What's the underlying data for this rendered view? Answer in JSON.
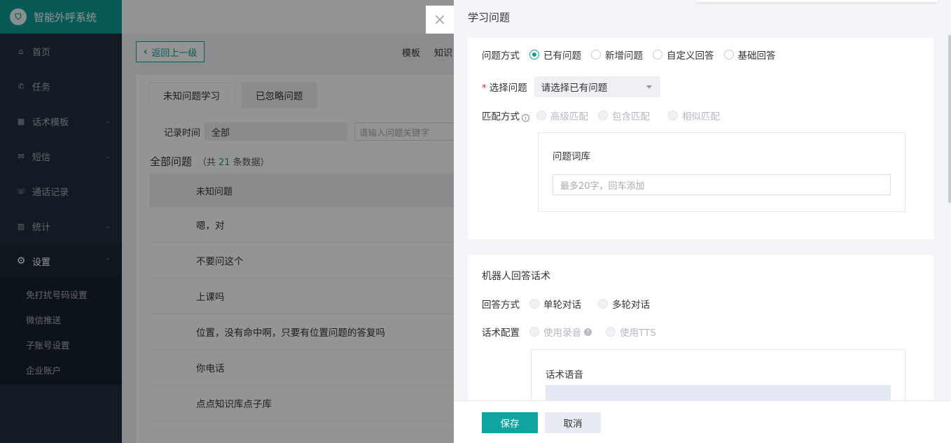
{
  "app": {
    "title": "智能外呼系统",
    "logo_icon": "tooth-icon"
  },
  "sidebar": {
    "items": [
      {
        "label": "首页",
        "icon": "home-icon",
        "glyph": "⌂",
        "chevron": ""
      },
      {
        "label": "任务",
        "icon": "phone-icon",
        "glyph": "✆",
        "chevron": ""
      },
      {
        "label": "话术模板",
        "icon": "sitemap-icon",
        "glyph": "▦",
        "chevron": "⌄"
      },
      {
        "label": "短信",
        "icon": "mail-icon",
        "glyph": "✉",
        "chevron": "⌄"
      },
      {
        "label": "通话记录",
        "icon": "call-log-icon",
        "glyph": "☏",
        "chevron": ""
      },
      {
        "label": "统计",
        "icon": "bar-chart-icon",
        "glyph": "▥",
        "chevron": "⌄"
      },
      {
        "label": "设置",
        "icon": "gear-icon",
        "glyph": "⚙",
        "chevron": "⌃"
      }
    ],
    "sub_items": [
      "免打扰号码设置",
      "微信推送",
      "子账号设置",
      "企业账户"
    ]
  },
  "main": {
    "back_label": "返回上一级",
    "toolbar_links": [
      "模板",
      "知识"
    ],
    "tabs": [
      "未知问题学习",
      "已忽略问题"
    ],
    "filter": {
      "label": "记录时间",
      "value": "全部",
      "search_placeholder": "请输入问题关键字"
    },
    "count": {
      "title": "全部问题",
      "prefix": "（共",
      "number": "21",
      "suffix": "条数据）"
    },
    "table": {
      "header": "未知问题",
      "rows": [
        "嗯，对",
        "不要问这个",
        "上课吗",
        "位置，没有命中啊，只要有位置问题的答复吗",
        "你电话",
        "点点知识库点子库"
      ]
    }
  },
  "drawer": {
    "title": "学习问题",
    "close": "×",
    "question_mode": {
      "label": "问题方式",
      "options": [
        "已有问题",
        "新增问题",
        "自定义回答",
        "基础回答"
      ],
      "selected": "已有问题"
    },
    "select_question": {
      "required": "*",
      "label": "选择问题",
      "placeholder": "请选择已有问题"
    },
    "match_mode": {
      "label": "匹配方式",
      "info": "i",
      "options": [
        "高级匹配",
        "包含匹配",
        "相似匹配"
      ]
    },
    "lexicon": {
      "title": "问题词库",
      "placeholder": "最多20字，回车添加"
    },
    "robot": {
      "title": "机器人回答话术",
      "answer_mode": {
        "label": "回答方式",
        "options": [
          "单轮对话",
          "多轮对话"
        ]
      },
      "script_config": {
        "label": "话术配置",
        "options": [
          "使用录音",
          "使用TTS"
        ],
        "help": "?"
      },
      "voice_title": "话术语音"
    },
    "buttons": {
      "save": "保存",
      "cancel": "取消"
    }
  }
}
